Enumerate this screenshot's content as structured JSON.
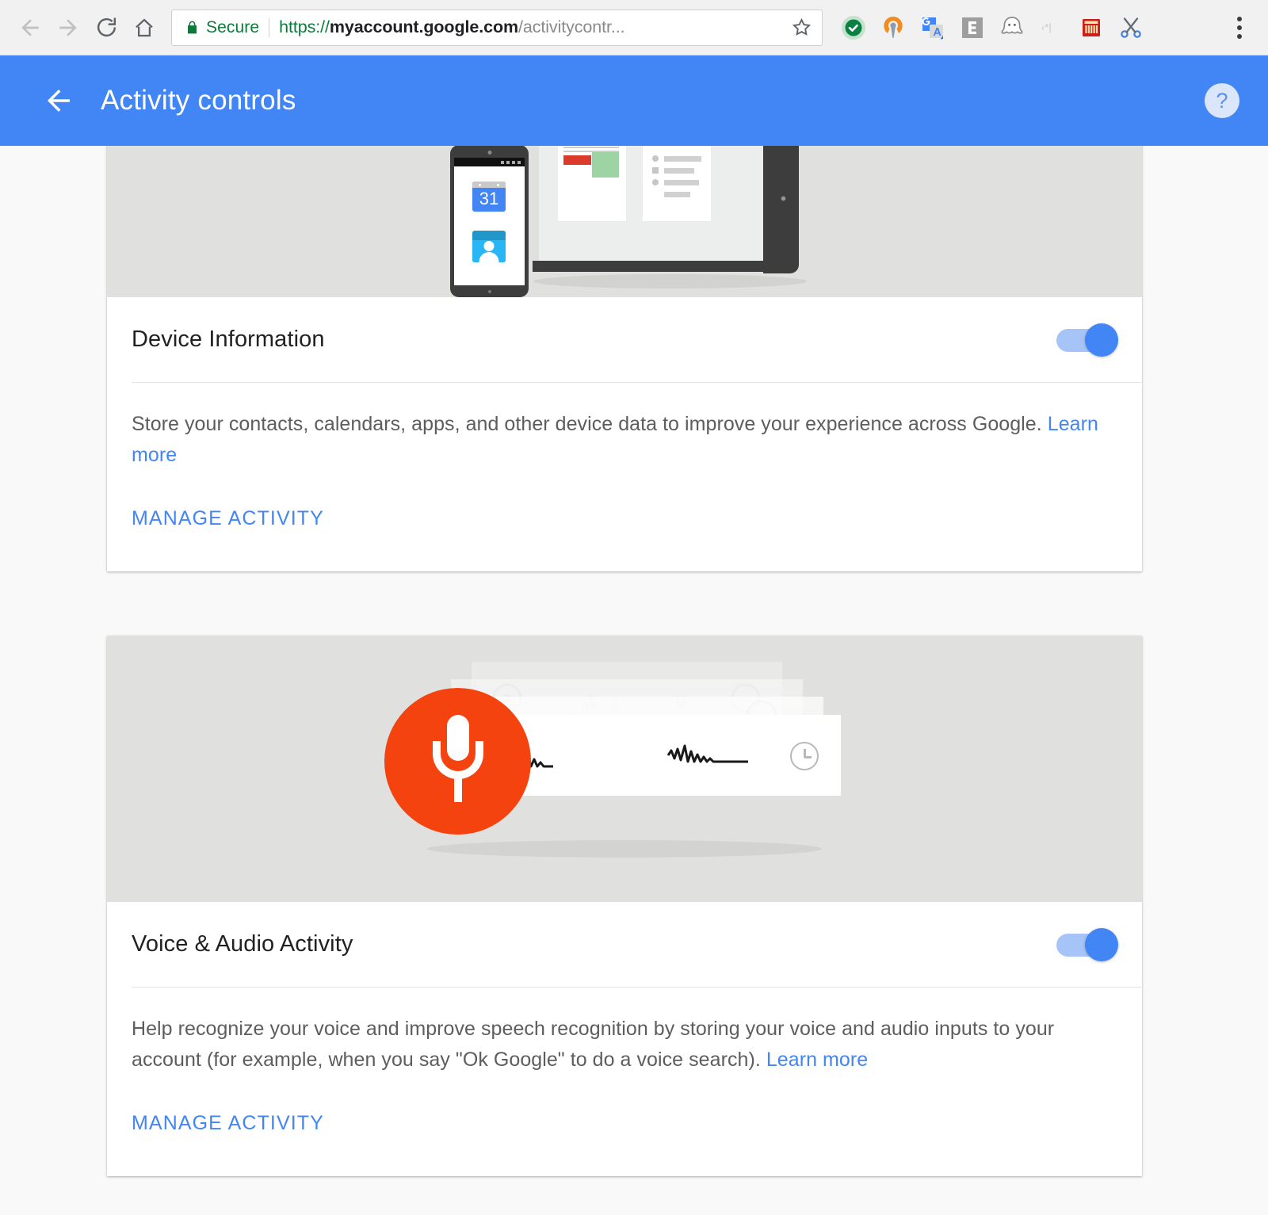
{
  "browser": {
    "back_icon": "arrow-left-icon",
    "forward_icon": "arrow-right-icon",
    "reload_icon": "reload-icon",
    "home_icon": "home-icon",
    "lock_icon": "lock-icon",
    "security_label": "Secure",
    "url_scheme": "https://",
    "url_host": "myaccount.google.com",
    "url_path": "/activitycontr...",
    "bookmark_icon": "star-icon",
    "menu_icon": "three-dot-menu-icon",
    "extensions": [
      {
        "name": "checkmark-shield-extension-icon",
        "color": "#0a8043"
      },
      {
        "name": "openvpn-extension-icon",
        "color": "#f08c22"
      },
      {
        "name": "google-translate-extension-icon",
        "color": "#4285f4"
      },
      {
        "name": "evernote-extension-icon",
        "color": "#9e9e9e"
      },
      {
        "name": "ghostery-extension-icon",
        "color": "#8a8a8a"
      },
      {
        "name": "text-tools-extension-icon",
        "color": "#c9c9c9"
      },
      {
        "name": "abacus-extension-icon",
        "color": "#cc1f1a"
      },
      {
        "name": "scissors-clip-extension-icon",
        "color": "#4a7fd6"
      }
    ]
  },
  "header": {
    "back_icon": "arrow-back-icon",
    "title": "Activity controls",
    "help_icon": "help-question-icon",
    "background_color": "#4285f4"
  },
  "cards": [
    {
      "id": "device-information",
      "illustration": "devices-phone-laptop-tablet-illustration",
      "calendar_day": "31",
      "title": "Device Information",
      "toggle": {
        "name": "device-information-toggle",
        "state": "on",
        "color": "#4285f4"
      },
      "description_text": "Store your contacts, calendars, apps, and other device data to improve your experience across Google. ",
      "learn_more_label": "Learn more",
      "manage_label": "MANAGE ACTIVITY"
    },
    {
      "id": "voice-and-audio-activity",
      "illustration": "microphone-waveform-illustration",
      "title": "Voice & Audio Activity",
      "toggle": {
        "name": "voice-audio-activity-toggle",
        "state": "on",
        "color": "#4285f4"
      },
      "description_text": "Help recognize your voice and improve speech recognition by storing your voice and audio inputs to your account (for example, when you say \"Ok Google\" to do a voice search). ",
      "learn_more_label": "Learn more",
      "manage_label": "MANAGE ACTIVITY"
    }
  ],
  "colors": {
    "accent": "#4285f4",
    "page_background": "#f9f9f9",
    "illustration_background": "#e0e0de",
    "mic_orange": "#f4430f",
    "secure_green": "#0b7b39"
  }
}
